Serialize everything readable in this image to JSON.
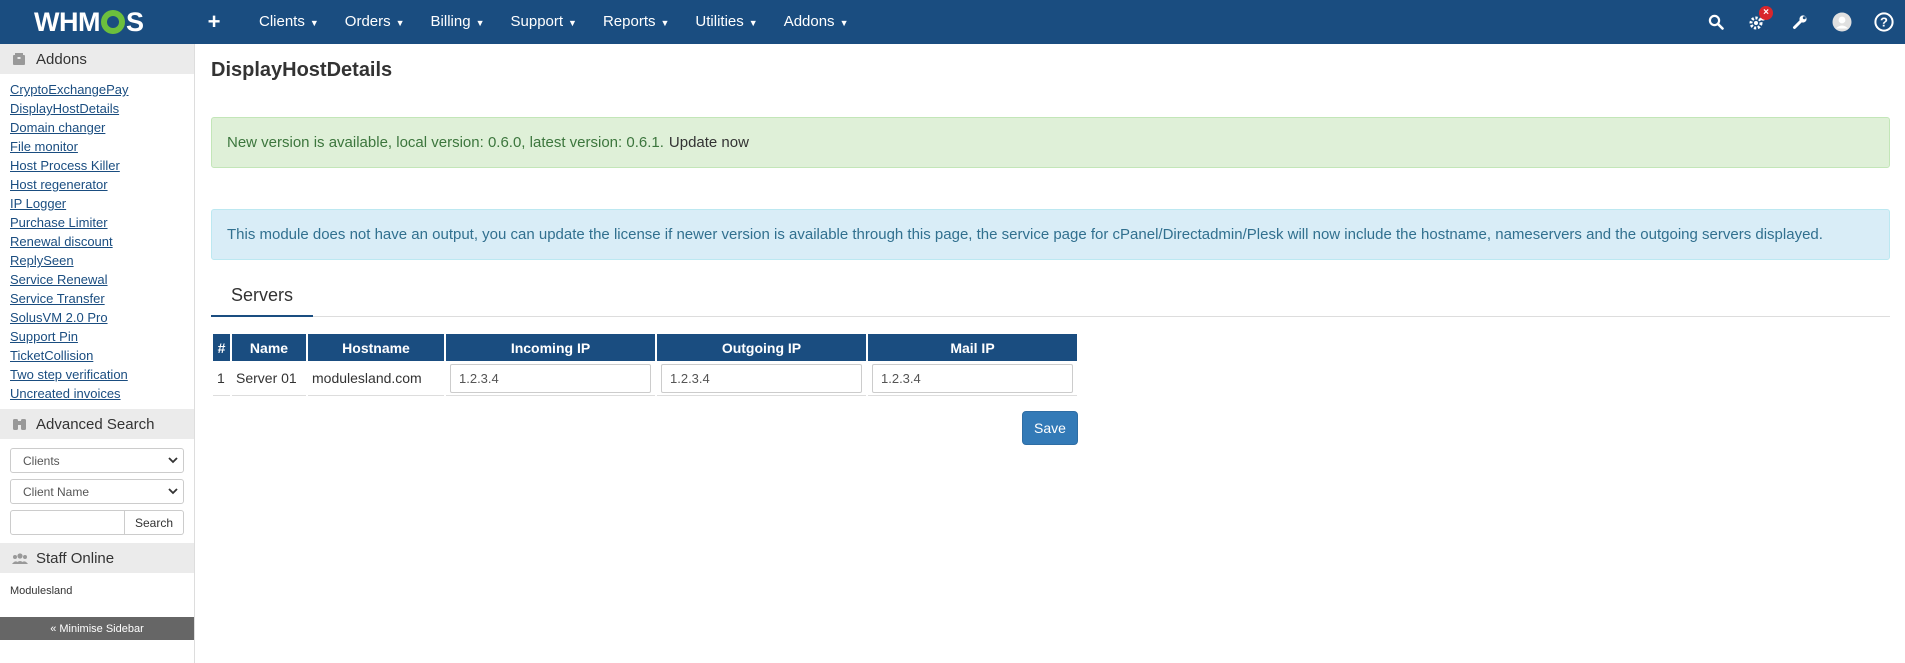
{
  "topbar": {
    "brand_left": "WHM",
    "brand_right": "S",
    "plus": "+",
    "nav": [
      {
        "label": "Clients"
      },
      {
        "label": "Orders"
      },
      {
        "label": "Billing"
      },
      {
        "label": "Support"
      },
      {
        "label": "Reports"
      },
      {
        "label": "Utilities"
      },
      {
        "label": "Addons"
      }
    ],
    "badge": "×"
  },
  "sidebar": {
    "addons_title": "Addons",
    "addons": [
      "CryptoExchangePay",
      "DisplayHostDetails",
      "Domain changer",
      "File monitor",
      "Host Process Killer",
      "Host regenerator",
      "IP Logger",
      "Purchase Limiter",
      "Renewal discount",
      "ReplySeen",
      "Service Renewal",
      "Service Transfer",
      "SolusVM 2.0 Pro",
      "Support Pin",
      "TicketCollision",
      "Two step verification",
      "Uncreated invoices"
    ],
    "search_title": "Advanced Search",
    "search_type": "Clients",
    "search_field": "Client Name",
    "search_button": "Search",
    "staff_title": "Staff Online",
    "staff_name": "Modulesland",
    "minimise": "« Minimise Sidebar"
  },
  "main": {
    "title": "DisplayHostDetails",
    "alert_success": "New version is available, local version: 0.6.0, latest version: 0.6.1.",
    "alert_success_link": "Update now",
    "alert_info": "This module does not have an output, you can update the license if newer version is available through this page, the service page for cPanel/Directadmin/Plesk will now include the hostname, nameservers and the outgoing servers displayed.",
    "tab": "Servers",
    "table": {
      "headers": [
        "#",
        "Name",
        "Hostname",
        "Incoming IP",
        "Outgoing IP",
        "Mail IP"
      ],
      "rows": [
        {
          "num": "1",
          "name": "Server 01",
          "hostname": "modulesland.com",
          "incoming": "1.2.3.4",
          "outgoing": "1.2.3.4",
          "mail": "1.2.3.4"
        }
      ]
    },
    "save": "Save"
  },
  "colors": {
    "topbar": "#1a4d80",
    "brand_accent": "#6cbf3d",
    "save": "#337ab7",
    "badge": "#d9262b"
  }
}
